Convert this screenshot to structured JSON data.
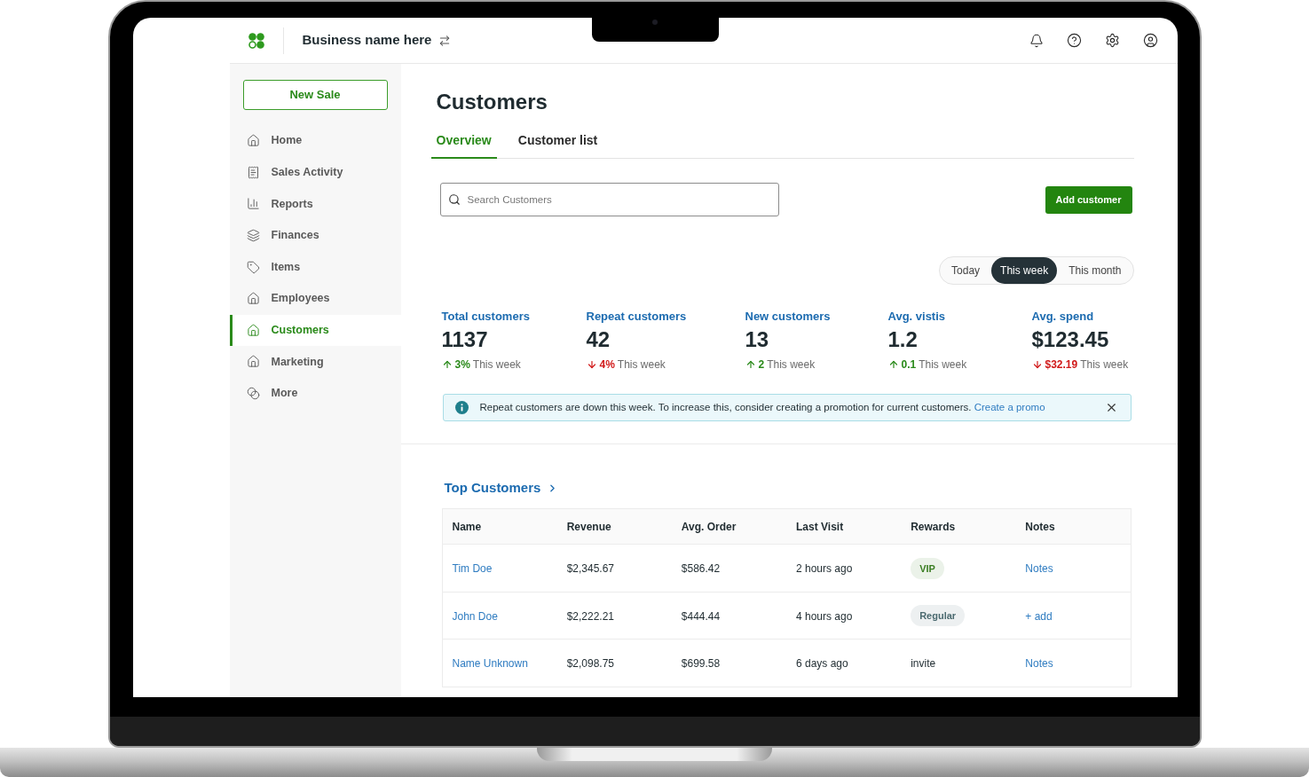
{
  "header": {
    "business_name": "Business name here"
  },
  "sidebar": {
    "new_sale_button": "New Sale",
    "items": [
      {
        "label": "Home",
        "selected": false
      },
      {
        "label": "Sales Activity",
        "selected": false
      },
      {
        "label": "Reports",
        "selected": false
      },
      {
        "label": "Finances",
        "selected": false
      },
      {
        "label": "Items",
        "selected": false
      },
      {
        "label": "Employees",
        "selected": false
      },
      {
        "label": "Customers",
        "selected": true
      },
      {
        "label": "Marketing",
        "selected": false
      },
      {
        "label": "More",
        "selected": false
      }
    ]
  },
  "page": {
    "title": "Customers"
  },
  "tabs": [
    {
      "label": "Overview",
      "selected": true
    },
    {
      "label": "Customer list",
      "selected": false
    }
  ],
  "search": {
    "placeholder": "Search Customers"
  },
  "add_customer_button": "Add customer",
  "time_range": [
    {
      "label": "Today",
      "selected": false
    },
    {
      "label": "This week",
      "selected": true
    },
    {
      "label": "This month",
      "selected": false
    }
  ],
  "stats": [
    {
      "label": "Total customers",
      "value": "1137",
      "rising": true,
      "change": "3%",
      "period": "This week"
    },
    {
      "label": "Repeat customers",
      "value": "42",
      "rising": false,
      "change": "4%",
      "period": "This week"
    },
    {
      "label": "New customers",
      "value": "13",
      "rising": true,
      "change": "2",
      "period": "This week"
    },
    {
      "label": "Avg. vistis",
      "value": "1.2",
      "rising": true,
      "change": "0.1",
      "period": "This week"
    },
    {
      "label": "Avg. spend",
      "value": "$123.45",
      "rising": false,
      "change": "$32.19",
      "period": "This week"
    }
  ],
  "alert": {
    "message": "Repeat customers are down this week. To increase this, consider creating a promotion for current customers.",
    "link": "Create a promo"
  },
  "top_customers": {
    "title": "Top Customers",
    "columns": [
      "Name",
      "Revenue",
      "Avg. Order",
      "Last Visit",
      "Rewards",
      "Notes"
    ],
    "rows": [
      {
        "name": "Tim Doe",
        "revenue": "$2,345.67",
        "avg_order": "$586.42",
        "last_visit": "2 hours ago",
        "rewards": {
          "kind": "badge",
          "label": "VIP",
          "color": "#3a7d22"
        },
        "notes": "Notes"
      },
      {
        "name": "John Doe",
        "revenue": "$2,222.21",
        "avg_order": "$444.44",
        "last_visit": "4 hours ago",
        "rewards": {
          "kind": "badge",
          "label": "Regular",
          "color": "#4b6a70"
        },
        "notes": "+ add"
      },
      {
        "name": "Name Unknown",
        "revenue": "$2,098.75",
        "avg_order": "$699.58",
        "last_visit": "6 days ago",
        "rewards": {
          "kind": "text",
          "label": "invite"
        },
        "notes": "Notes"
      }
    ]
  }
}
